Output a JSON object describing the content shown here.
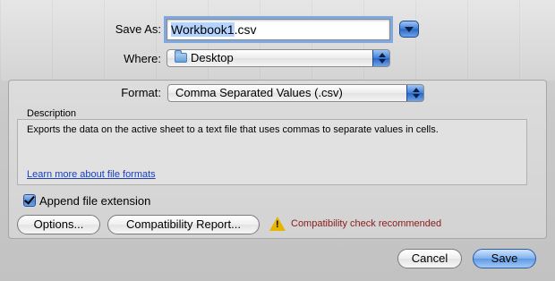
{
  "save_as": {
    "label": "Save As:",
    "value_selected": "Workbook1",
    "value_rest": ".csv"
  },
  "where": {
    "label": "Where:",
    "value": "Desktop",
    "icon": "folder-icon"
  },
  "format": {
    "label": "Format:",
    "value": "Comma Separated Values (.csv)"
  },
  "description": {
    "label": "Description",
    "text": "Exports the data on the active sheet to a text file that uses commas to separate values in cells.",
    "link": "Learn more about file formats"
  },
  "append_extension": {
    "label": "Append file extension",
    "checked": true
  },
  "buttons": {
    "options": "Options...",
    "compatibility": "Compatibility Report...",
    "cancel": "Cancel",
    "save": "Save"
  },
  "warning": {
    "text": "Compatibility check recommended",
    "color": "#8b1a1a"
  },
  "colors": {
    "accent": "#4a86d8",
    "warning_icon": "#e7b500"
  }
}
